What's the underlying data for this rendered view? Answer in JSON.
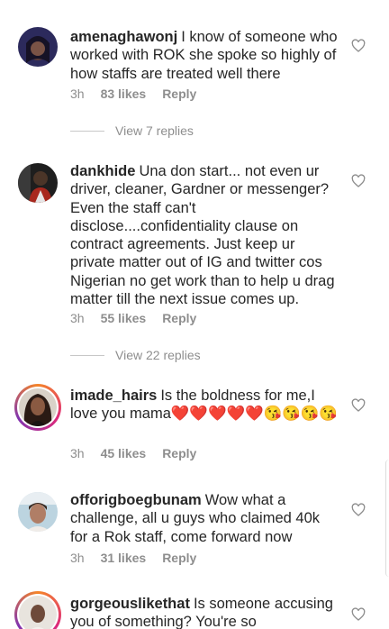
{
  "comments": [
    {
      "username": "amenaghawonj",
      "text": "I know of someone who worked with ROK she spoke so highly of how staffs are treated well there",
      "time": "3h",
      "likes": "83 likes",
      "reply": "Reply"
    },
    {
      "username": "dankhide",
      "text": "Una don start... not even ur driver, cleaner, Gardner or messenger? Even the staff can't disclose....confidentiality clause on contract agreements. Just keep ur private matter out of IG and twitter cos Nigerian no get work than to help u drag matter till the next issue comes up.",
      "time": "3h",
      "likes": "55 likes",
      "reply": "Reply"
    },
    {
      "username": "imade_hairs",
      "text": "Is the boldness for me,I love you mama",
      "emoji": "❤️❤️❤️❤️❤️😘😘😘😘",
      "time": "3h",
      "likes": "45 likes",
      "reply": "Reply"
    },
    {
      "username": "offorigboegbunam",
      "text": "Wow what a challenge, all u guys who claimed 40k for a Rok staff, come forward now",
      "time": "3h",
      "likes": "31 likes",
      "reply": "Reply"
    },
    {
      "username": "gorgeouslikethat",
      "text": "Is someone accusing you of something? You're so"
    }
  ],
  "view_replies": [
    "View 7 replies",
    "View 22 replies"
  ],
  "icons": {
    "like": "heart-outline-icon"
  }
}
